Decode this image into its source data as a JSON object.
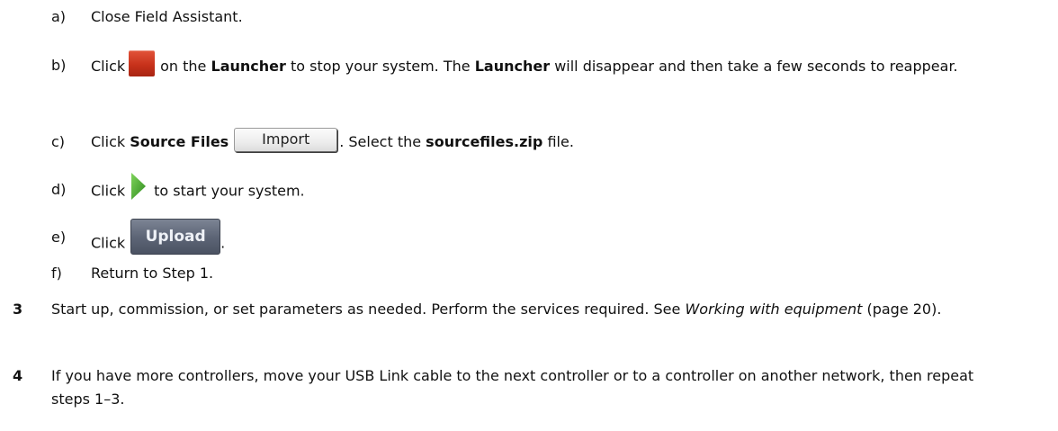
{
  "substeps": {
    "a": {
      "letter": "a)",
      "text": "Close Field Assistant."
    },
    "b": {
      "letter": "b)",
      "click": "Click",
      "icon": "stop-icon",
      "text1": "on the",
      "launcher": "Launcher",
      "text2": "to stop your system. The",
      "launcher2": "Launcher",
      "text3": "will disappear and then take a few seconds to reappear."
    },
    "c": {
      "letter": "c)",
      "click": "Click",
      "source_files": "Source Files",
      "import_label": "Import",
      "text1": ". Select the",
      "file_name": "sourcefiles.zip",
      "text2": "file."
    },
    "d": {
      "letter": "d)",
      "click": "Click",
      "icon": "start-icon",
      "text": "to start your system."
    },
    "e": {
      "letter": "e)",
      "click": "Click",
      "upload_label": "Upload",
      "end": "."
    },
    "f": {
      "letter": "f)",
      "text": "Return to Step 1."
    }
  },
  "steps": {
    "three": {
      "number": "3",
      "text1": "Start up, commission, or set parameters as needed. Perform the services required. See",
      "link": "Working with equipment",
      "text2": "(page 20)."
    },
    "four": {
      "number": "4",
      "text": "If you have more controllers, move your USB Link cable to the next controller or to a controller on another network, then repeat steps 1–3."
    }
  },
  "colors": {
    "stop_icon": "#c8321b",
    "start_icon": "#4caa2e",
    "upload_button": "#5e6677"
  }
}
